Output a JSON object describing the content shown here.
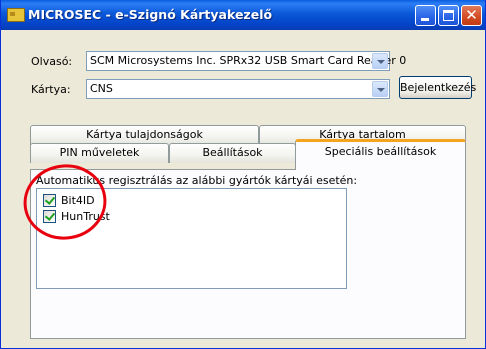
{
  "window": {
    "title": "MICROSEC - e-Szignó Kártyakezelő"
  },
  "form": {
    "reader_label": "Olvasó:",
    "reader_value": "SCM Microsystems Inc. SPRx32 USB Smart Card Reader 0",
    "card_label": "Kártya:",
    "card_value": "CNS",
    "login_button": "Bejelentkezés"
  },
  "tabs": {
    "row1": [
      "Kártya tulajdonságok",
      "Kártya tartalom"
    ],
    "row2": [
      "PIN műveletek",
      "Beállítások",
      "Speciális beállítások"
    ]
  },
  "special": {
    "group_label": "Automatikus regisztrálás az alábbi gyártók kártyái esetén:",
    "items": [
      {
        "label": "Bit4ID",
        "checked": true
      },
      {
        "label": "HunTrust",
        "checked": true
      }
    ]
  },
  "annotation": {
    "color": "#E8000E"
  }
}
